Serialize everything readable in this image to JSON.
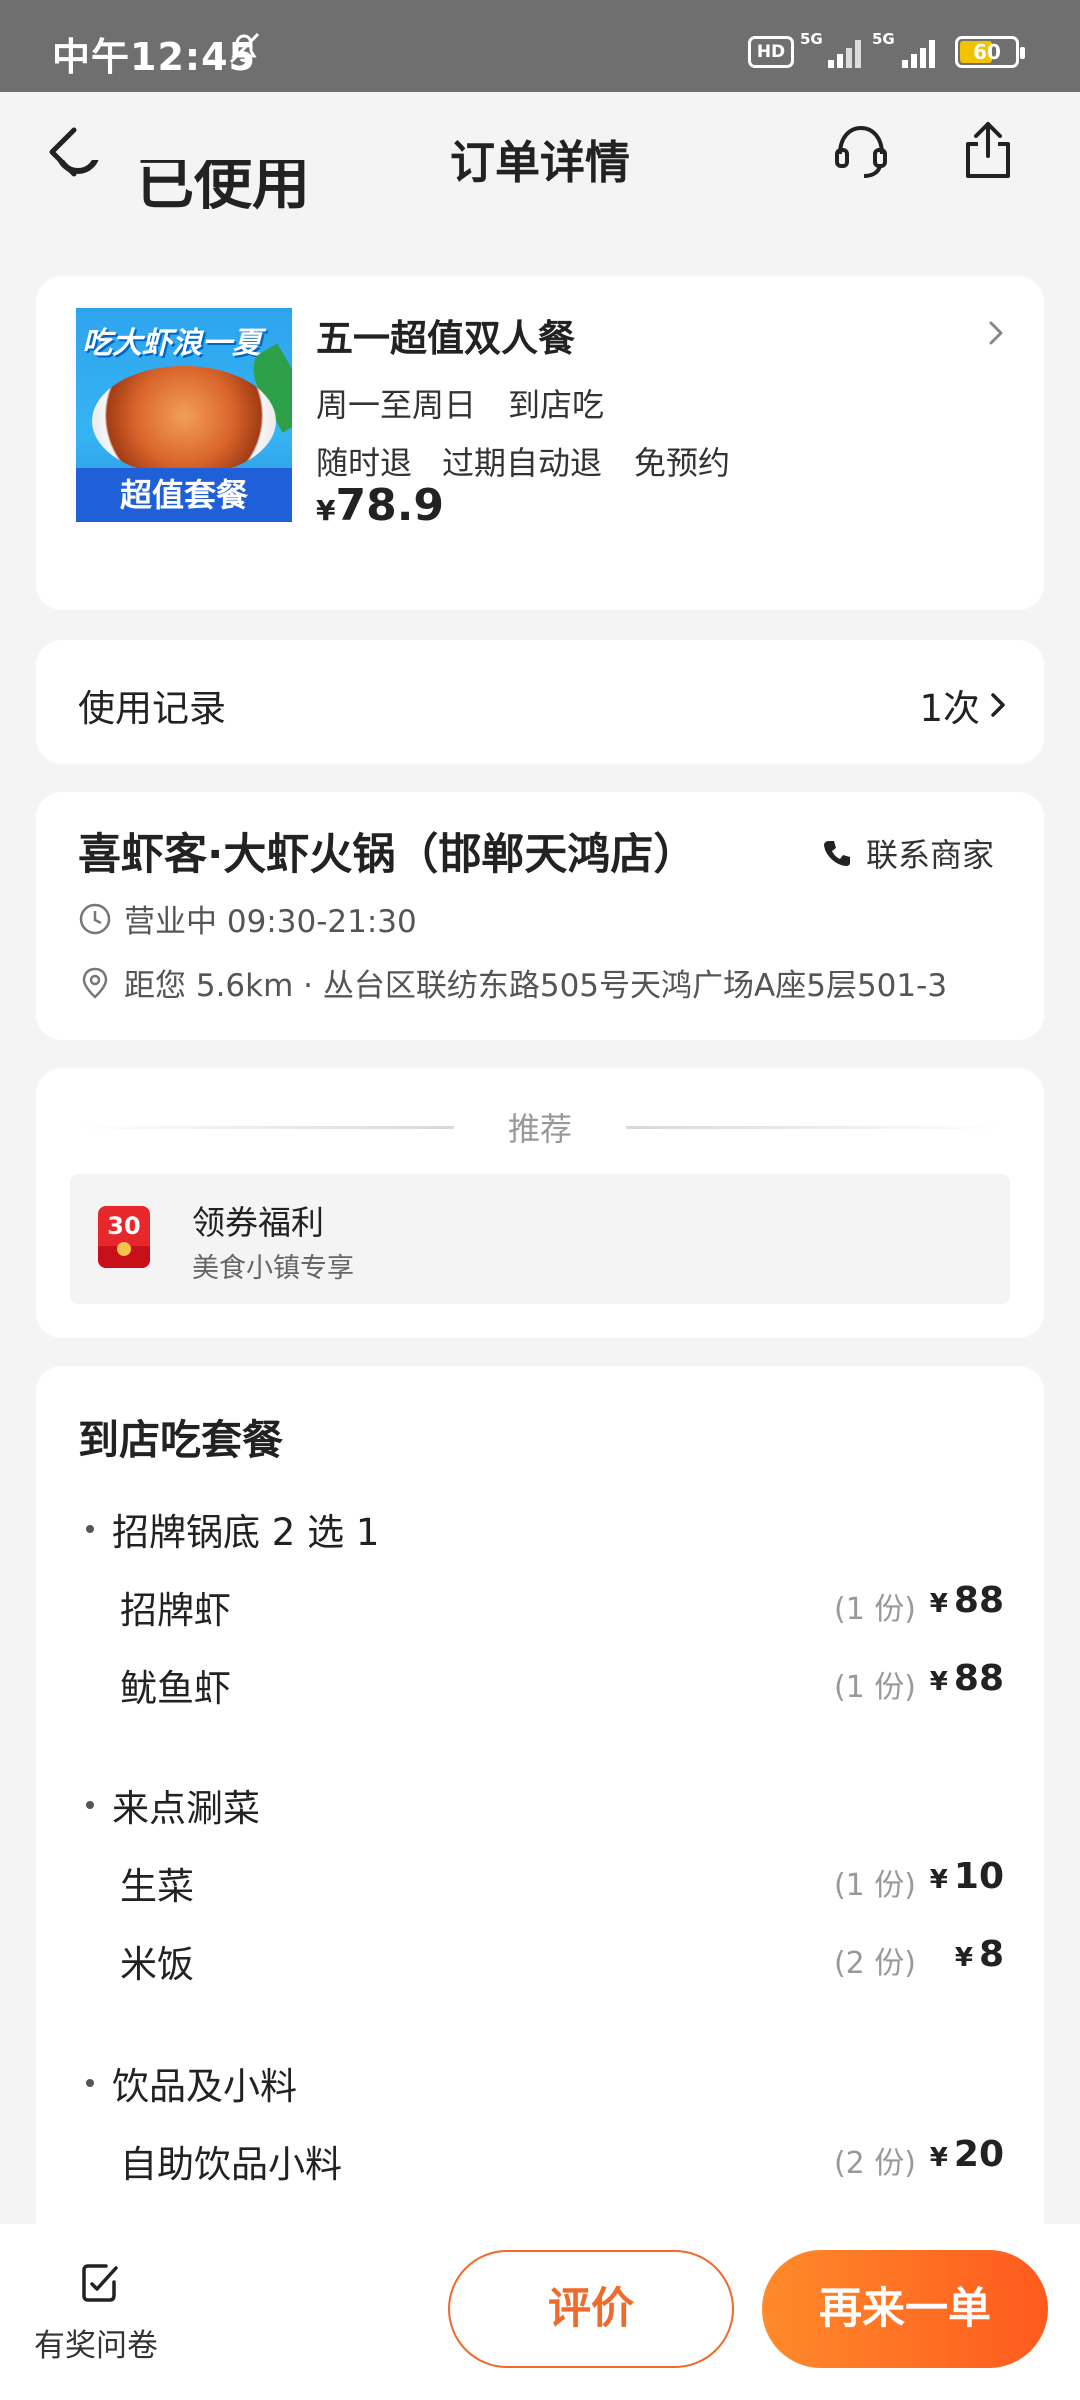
{
  "status_bar": {
    "time": "中午12:45",
    "hd_label": "HD",
    "net1": "5G",
    "net2": "5G",
    "battery": "60",
    "battery_level": 0.6
  },
  "header": {
    "title": "订单详情"
  },
  "order_status_partial": "已使用",
  "product": {
    "image_top_text": "吃大虾浪一夏",
    "image_bottom_text": "超值套餐",
    "name": "五一超值双人餐",
    "tags_line1": [
      "周一至周日",
      "到店吃"
    ],
    "tags_line2": [
      "随时退",
      "过期自动退",
      "免预约"
    ],
    "currency": "¥",
    "price": "78.9"
  },
  "usage_record": {
    "label": "使用记录",
    "count": "1次"
  },
  "store": {
    "name": "喜虾客·大虾火锅（邯郸天鸿店）",
    "contact_label": "联系商家",
    "hours": "营业中 09:30-21:30",
    "distance": "距您 5.6km · 丛台区联纺东路505号天鸿广场A座5层501-3"
  },
  "recommend": {
    "title": "推荐",
    "item_badge": "30",
    "item_name": "领券福利",
    "item_sub": "美食小镇专享"
  },
  "package": {
    "title": "到店吃套餐",
    "groups": [
      {
        "title": "招牌锅底 2 选 1",
        "items": [
          {
            "name": "招牌虾",
            "qty": "(1 份)",
            "currency": "¥",
            "price": "88"
          },
          {
            "name": "鱿鱼虾",
            "qty": "(1 份)",
            "currency": "¥",
            "price": "88"
          }
        ]
      },
      {
        "title": "来点涮菜",
        "items": [
          {
            "name": "生菜",
            "qty": "(1 份)",
            "currency": "¥",
            "price": "10"
          },
          {
            "name": "米饭",
            "qty": "(2 份)",
            "currency": "¥",
            "price": "8"
          }
        ]
      },
      {
        "title": "饮品及小料",
        "items": [
          {
            "name": "自助饮品小料",
            "qty": "(2 份)",
            "currency": "¥",
            "price": "20"
          }
        ]
      }
    ]
  },
  "bottom_bar": {
    "survey_label": "有奖问卷",
    "review_label": "评价",
    "reorder_label": "再来一单"
  },
  "colors": {
    "accent": "#f06a2a",
    "accent_gradient_start": "#ff8a2a",
    "accent_gradient_end": "#ff5a1e",
    "background": "#f4f4f4"
  }
}
